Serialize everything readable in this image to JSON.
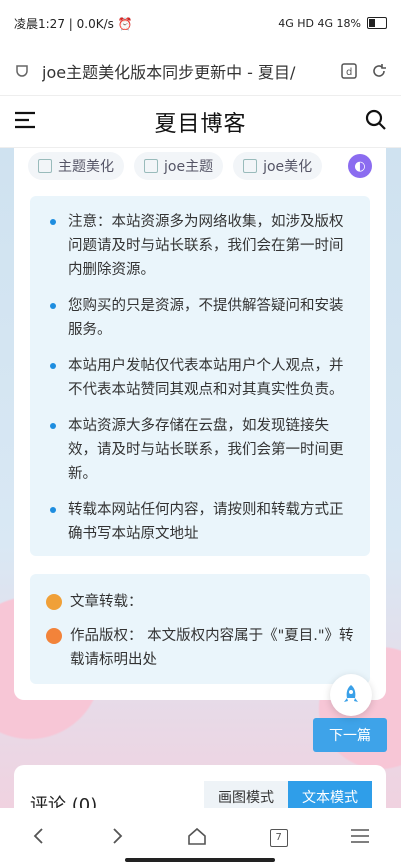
{
  "statusbar": {
    "left": "凌晨1:27 | 0.0K/s ⏰",
    "right": "4G HD 4G 18%"
  },
  "browser": {
    "url_title": "joe主题美化版本同步更新中 - 夏目/",
    "tab_count": "7"
  },
  "header": {
    "title": "夏目博客"
  },
  "tags": [
    {
      "label": "主题美化"
    },
    {
      "label": "joe主题"
    },
    {
      "label": "joe美化"
    }
  ],
  "notice": {
    "items": [
      "注意：本站资源多为网络收集，如涉及版权问题请及时与站长联系，我们会在第一时间内删除资源。",
      "您购买的只是资源，不提供解答疑问和安装服务。",
      "本站用户发帖仅代表本站用户个人观点，并不代表本站赞同其观点和对其真实性负责。",
      "本站资源大多存储在云盘，如发现链接失效，请及时与站长联系，我们会第一时间更新。",
      "转载本网站任何内容，请按则和转载方式正确书写本站原文地址"
    ]
  },
  "copyright": {
    "reprint": "文章转载：",
    "rights": "作品版权： 本文版权内容属于《\"夏目.\"》转载请标明出处"
  },
  "buttons": {
    "next": "下一篇"
  },
  "comments": {
    "title": "评论 (0)",
    "mode_image": "画图模式",
    "mode_text": "文本模式"
  }
}
